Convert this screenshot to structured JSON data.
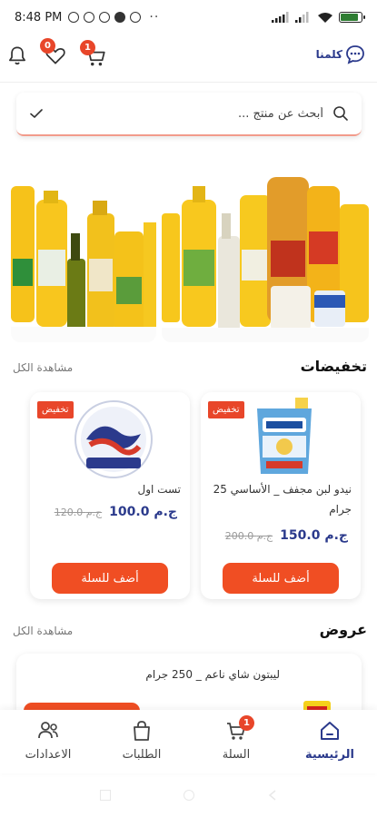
{
  "status": {
    "time": "8:48 PM",
    "battery_level": 0.85
  },
  "top_bar": {
    "chat_label": "كلمنا",
    "favorites_count": "0",
    "cart_count": "1"
  },
  "search": {
    "placeholder": "أبحث عن منتج ..."
  },
  "discounts": {
    "title": "تخفيضات",
    "see_all": "مشاهدة الكل",
    "products": [
      {
        "name": "نيدو لبن مجفف _ الأساسي 25 جرام",
        "sale_tag": "تخفيض",
        "old_price": "200.0 ج.م",
        "new_price": "150.0 ج.م",
        "add_label": "أضف للسلة"
      },
      {
        "name": "تست اول",
        "sale_tag": "تخفيض",
        "old_price": "120.0 ج.م",
        "new_price": "100.0 ج.م",
        "add_label": "أضف للسلة"
      }
    ]
  },
  "offers": {
    "title": "عروض",
    "see_all": "مشاهدة الكل",
    "items": [
      {
        "name": "ليبتون شاي ناعم _ 250 جرام"
      }
    ]
  },
  "bottom_nav": {
    "items": [
      {
        "label": "الرئيسية",
        "icon": "home-icon",
        "active": true
      },
      {
        "label": "السلة",
        "icon": "cart-icon",
        "badge": "1"
      },
      {
        "label": "الطلبات",
        "icon": "bag-icon"
      },
      {
        "label": "الاعدادات",
        "icon": "settings-icon"
      }
    ]
  },
  "colors": {
    "accent": "#f04e23",
    "brand_blue": "#2b3a8c",
    "badge": "#e8462a"
  }
}
